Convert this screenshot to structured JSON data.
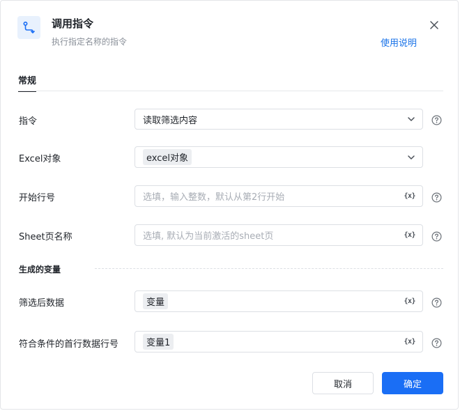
{
  "dialog": {
    "title": "调用指令",
    "subtitle": "执行指定名称的指令",
    "help_link": "使用说明"
  },
  "tabs": [
    {
      "label": "常规"
    }
  ],
  "fields": {
    "command": {
      "label": "指令",
      "value": "读取筛选内容"
    },
    "excel_object": {
      "label": "Excel对象",
      "value": "excel对象"
    },
    "start_row": {
      "label": "开始行号",
      "placeholder": "选填，输入整数，默认从第2行开始"
    },
    "sheet_name": {
      "label": "Sheet页名称",
      "placeholder": "选填, 默认为当前激活的sheet页"
    }
  },
  "generated": {
    "section_title": "生成的变量",
    "filtered_data": {
      "label": "筛选后数据",
      "value": "变量"
    },
    "first_row": {
      "label": "符合条件的首行数据行号",
      "value": "变量1"
    }
  },
  "variable_token": "{x}",
  "buttons": {
    "cancel": "取消",
    "ok": "确定"
  },
  "colors": {
    "accent": "#1a6ef5",
    "link": "#1a73e8"
  },
  "icons": {
    "header": "flow-connector-icon",
    "close": "close-icon",
    "help": "question-circle-icon",
    "dropdown": "chevron-down-icon"
  }
}
